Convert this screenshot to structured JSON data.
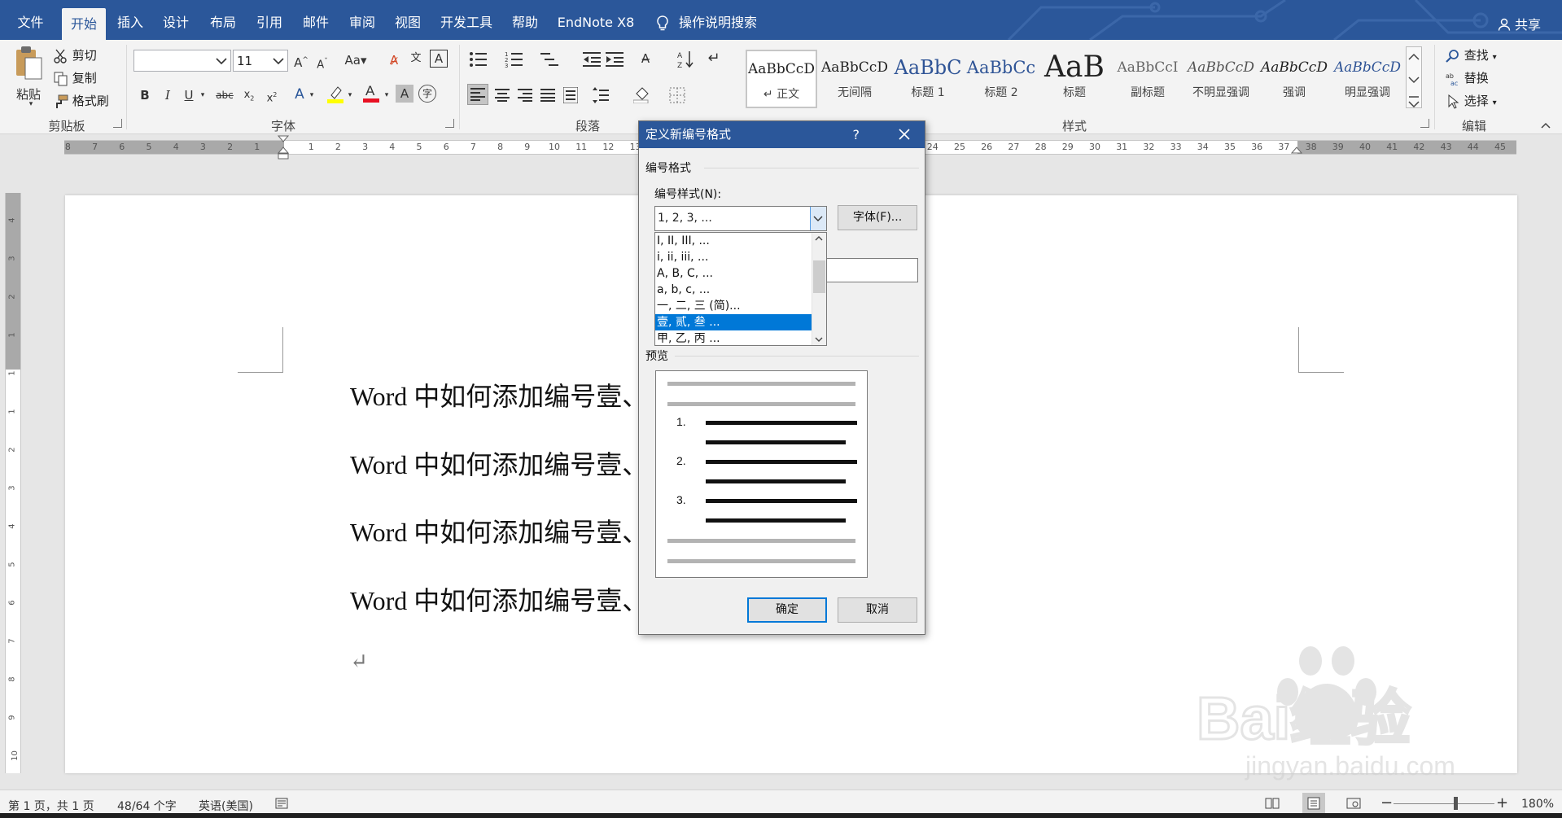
{
  "ribbon_tabs": [
    "文件",
    "开始",
    "插入",
    "设计",
    "布局",
    "引用",
    "邮件",
    "审阅",
    "视图",
    "开发工具",
    "帮助",
    "EndNote X8",
    "操作说明搜索"
  ],
  "active_tab": "开始",
  "share_label": "共享",
  "clipboard": {
    "paste": "粘贴",
    "cut": "剪切",
    "copy": "复制",
    "format_painter": "格式刷",
    "group": "剪贴板"
  },
  "font": {
    "name": "",
    "size": "11",
    "group": "字体",
    "aa": "Aa"
  },
  "paragraph": {
    "group": "段落"
  },
  "styles": {
    "group": "样式",
    "items": [
      {
        "preview": "AaBbCcD",
        "name": "↵ 正文"
      },
      {
        "preview": "AaBbCcD",
        "name": "无间隔"
      },
      {
        "preview": "AaBbC",
        "name": "标题 1"
      },
      {
        "preview": "AaBbCc",
        "name": "标题 2"
      },
      {
        "preview": "AaB",
        "name": "标题"
      },
      {
        "preview": "AaBbCcI",
        "name": "副标题"
      },
      {
        "preview": "AaBbCcD",
        "name": "不明显强调"
      },
      {
        "preview": "AaBbCcD",
        "name": "强调"
      },
      {
        "preview": "AaBbCcD",
        "name": "明显强调"
      }
    ]
  },
  "editing": {
    "find": "查找",
    "replace": "替换",
    "select": "选择",
    "group": "编辑"
  },
  "ruler_h_left": [
    "8",
    "7",
    "6",
    "5",
    "4",
    "3",
    "2",
    "1"
  ],
  "ruler_h_right": [
    "1",
    "2",
    "3",
    "4",
    "5",
    "6",
    "7",
    "8",
    "9",
    "10",
    "11",
    "12",
    "13",
    "24",
    "25",
    "26",
    "27",
    "28",
    "29",
    "30",
    "31",
    "32",
    "33",
    "34",
    "35",
    "36",
    "37",
    "38",
    "39",
    "40",
    "41",
    "42",
    "43",
    "44",
    "45"
  ],
  "ruler_v": [
    "4",
    "3",
    "2",
    "1",
    "1",
    "1",
    "2",
    "3",
    "4",
    "5",
    "6",
    "7",
    "8",
    "9",
    "10"
  ],
  "document": {
    "lines": [
      "Word 中如何添加编号壹、贰、",
      "Word 中如何添加编号壹、贰、",
      "Word 中如何添加编号壹、贰、",
      "Word 中如何添加编号壹、贰、"
    ],
    "para_mark": "↵"
  },
  "dialog": {
    "title": "定义新编号格式",
    "help": "?",
    "section_label": "编号格式",
    "style_label": "编号样式(N):",
    "style_value": "1, 2, 3, ...",
    "font_button": "字体(F)...",
    "options": [
      "I, II, III, ...",
      "i, ii, iii, ...",
      "A, B, C, ...",
      "a, b, c, ...",
      "一, 二, 三 (简)...",
      "壹, 贰, 叁 ...",
      "甲, 乙, 丙 ..."
    ],
    "selected_index": 5,
    "preview_label": "预览",
    "preview_numbers": [
      "1.",
      "2.",
      "3."
    ],
    "ok": "确定",
    "cancel": "取消"
  },
  "status": {
    "page": "第 1 页，共 1 页",
    "words": "48/64 个字",
    "lang": "英语(美国)",
    "zoom": "180%"
  },
  "watermark": {
    "text": "Bai经验",
    "url": "jingyan.baidu.com"
  },
  "colors": {
    "ribbon_blue": "#2b579a",
    "selection": "#0078d7",
    "font_red": "#e81123",
    "highlight_yellow": "#ffff00"
  }
}
